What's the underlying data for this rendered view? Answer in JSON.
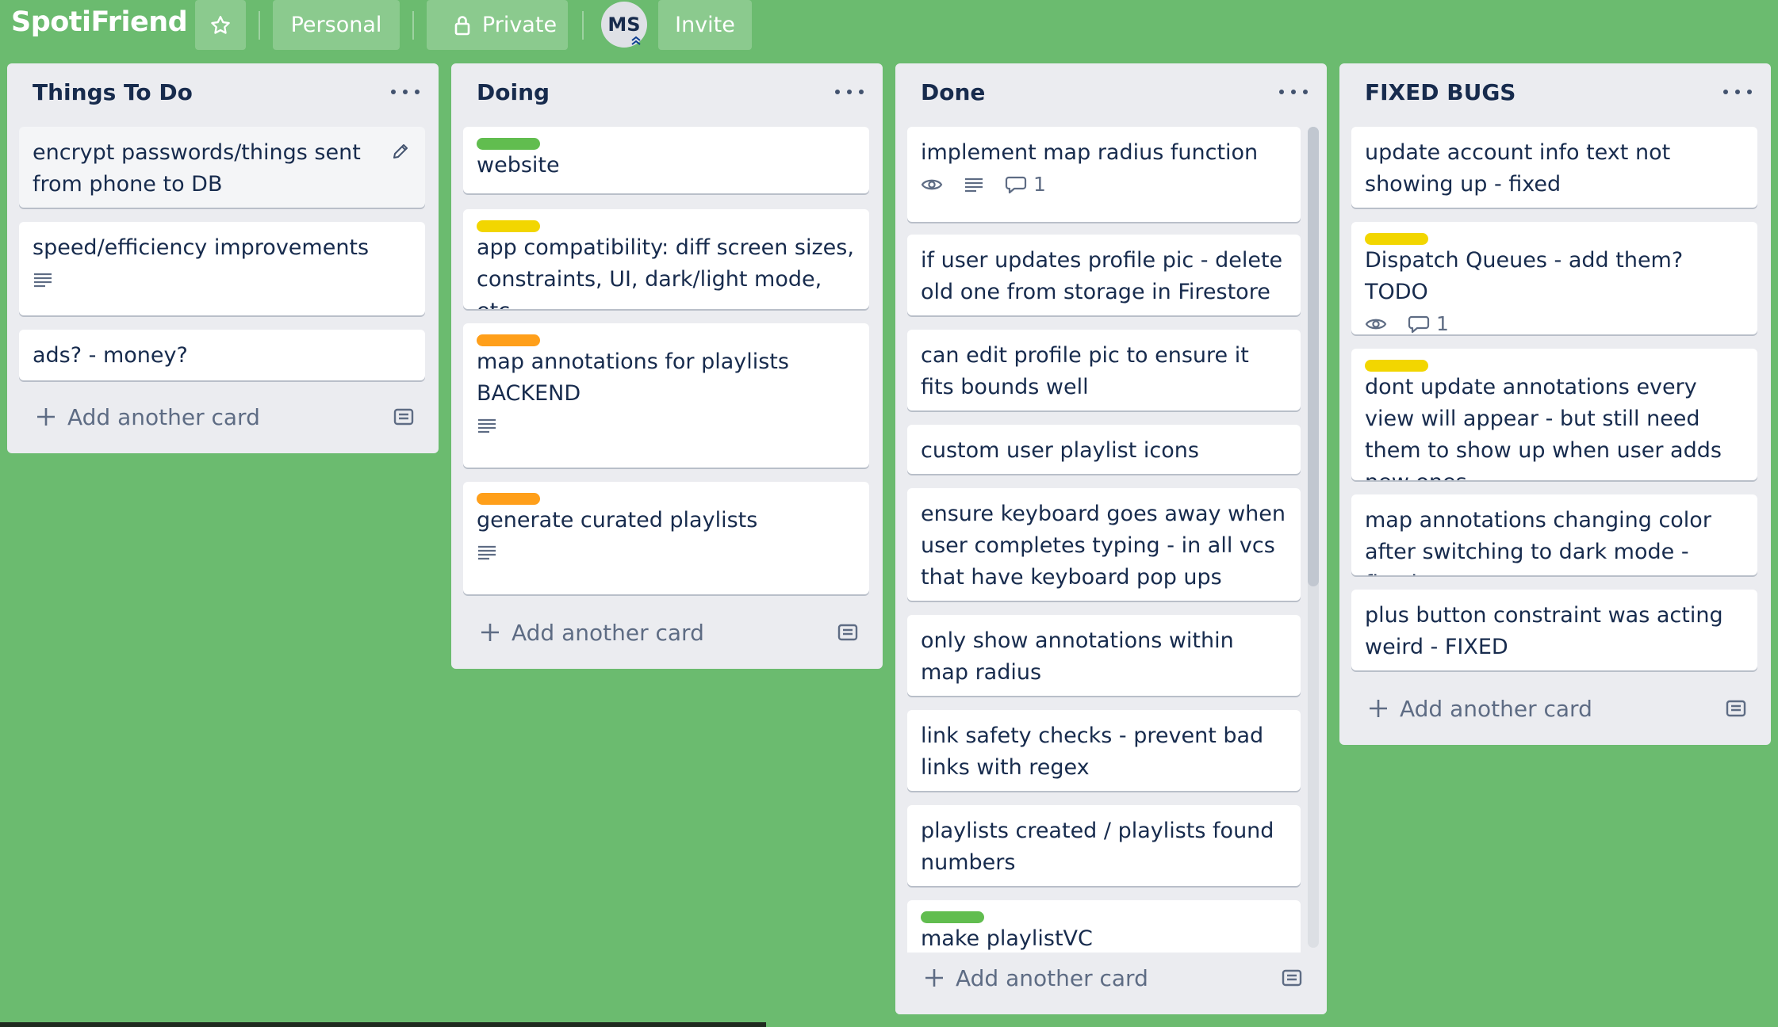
{
  "header": {
    "brand": "SpotiFriend",
    "personal_label": "Personal",
    "private_label": "Private",
    "avatar_initials": "MS",
    "invite_label": "Invite",
    "icons": {
      "star": "star-icon",
      "lock": "lock-icon",
      "badge": "double-chevron-up-icon"
    }
  },
  "add_card_label": "Add another card",
  "colors": {
    "background": "#6bbb6f",
    "list": "#ebecf0",
    "label_green": "#61bd4f",
    "label_yellow": "#f2d600",
    "label_orange": "#ff9f1a"
  },
  "lists": [
    {
      "title": "Things To Do",
      "cards": [
        {
          "title": "encrypt passwords/things sent from phone to DB",
          "labels": [],
          "badges": {}
        },
        {
          "title": "speed/efficiency improvements",
          "labels": [],
          "badges": {
            "description": true
          }
        },
        {
          "title": "ads? - money?",
          "labels": [],
          "badges": {}
        }
      ]
    },
    {
      "title": "Doing",
      "cards": [
        {
          "title": "website",
          "labels": [
            "green"
          ],
          "badges": {}
        },
        {
          "title": "app compatibility: diff screen sizes, constraints, UI, dark/light mode, etc.",
          "labels": [
            "yellow"
          ],
          "badges": {}
        },
        {
          "title": "map annotations for playlists BACKEND",
          "labels": [
            "orange"
          ],
          "badges": {
            "description": true
          }
        },
        {
          "title": "generate curated playlists",
          "labels": [
            "orange"
          ],
          "badges": {
            "description": true
          }
        }
      ]
    },
    {
      "title": "Done",
      "cards": [
        {
          "title": "implement map radius function",
          "labels": [],
          "badges": {
            "watching": true,
            "description": true,
            "comments": "1"
          }
        },
        {
          "title": "if user updates profile pic - delete old one from storage in Firestore",
          "labels": [],
          "badges": {}
        },
        {
          "title": "can edit profile pic to ensure it fits bounds well",
          "labels": [],
          "badges": {}
        },
        {
          "title": "custom user playlist icons",
          "labels": [],
          "badges": {}
        },
        {
          "title": "ensure keyboard goes away when user completes typing - in all vcs that have keyboard pop ups",
          "labels": [],
          "badges": {}
        },
        {
          "title": "only show annotations within map radius",
          "labels": [],
          "badges": {}
        },
        {
          "title": "link safety checks - prevent bad links with regex",
          "labels": [],
          "badges": {}
        },
        {
          "title": "playlists created / playlists found numbers",
          "labels": [],
          "badges": {}
        },
        {
          "title": "make playlistVC",
          "labels": [
            "green"
          ],
          "badges": {}
        }
      ]
    },
    {
      "title": "FIXED BUGS",
      "cards": [
        {
          "title": "update account info text not showing up - fixed",
          "labels": [],
          "badges": {}
        },
        {
          "title": "Dispatch Queues - add them? TODO",
          "labels": [
            "yellow"
          ],
          "badges": {
            "watching": true,
            "comments": "1"
          }
        },
        {
          "title": "dont update annotations every view will appear - but still need them to show up when user adds new ones",
          "labels": [
            "yellow"
          ],
          "badges": {}
        },
        {
          "title": "map annotations changing color after switching to dark mode - fixed",
          "labels": [],
          "badges": {}
        },
        {
          "title": "plus button constraint was acting weird - FIXED",
          "labels": [],
          "badges": {}
        }
      ]
    }
  ]
}
